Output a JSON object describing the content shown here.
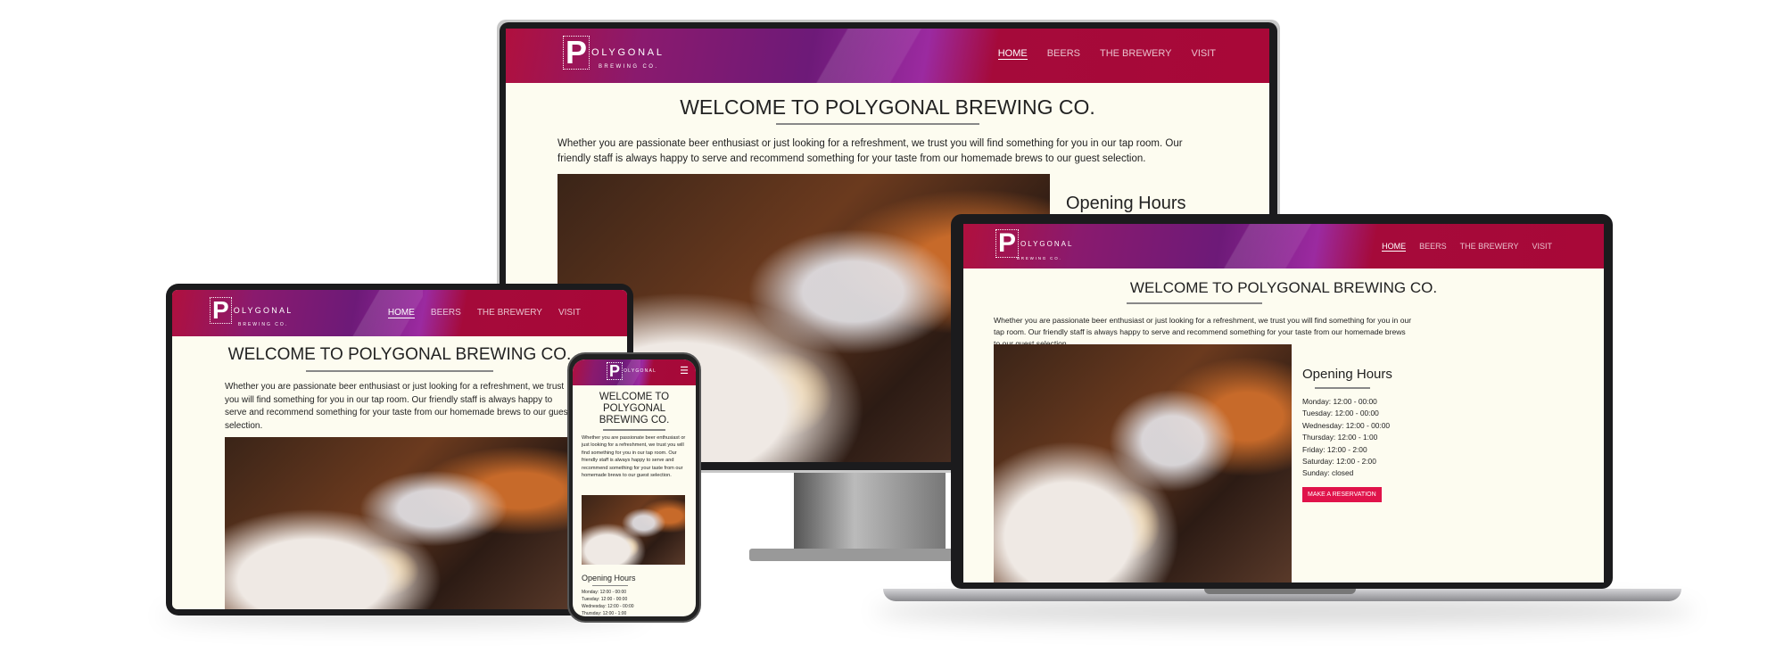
{
  "site": {
    "logo_letter": "P",
    "logo_word": "OLYGONAL",
    "logo_sub": "BREWING CO.",
    "nav": [
      "HOME",
      "BEERS",
      "THE BREWERY",
      "VISIT"
    ],
    "title": "WELCOME TO POLYGONAL BREWING CO.",
    "title_mobile_lines": [
      "WELCOME TO",
      "POLYGONAL",
      "BREWING CO."
    ],
    "intro": "Whether you are passionate beer enthusiast or just looking for a refreshment, we trust you will find something for you in our tap room. Our friendly staff is always happy to serve and recommend something for your taste from our homemade brews to our guest selection.",
    "hours_title": "Opening Hours",
    "hours": [
      "Monday: 12:00 - 00:00",
      "Tuesday: 12:00 - 00:00",
      "Wednesday: 12:00 - 00:00",
      "Thursday: 12:00 - 1:00",
      "Friday: 12:00 - 2:00",
      "Saturday: 12:00 - 2:00",
      "Sunday: closed"
    ],
    "reserve_label": "MAKE A RESERVATION",
    "menu_icon": "hamburger-icon"
  },
  "colors": {
    "header": "#a80838",
    "accent": "#e0134a",
    "background": "#fdfcf0"
  }
}
